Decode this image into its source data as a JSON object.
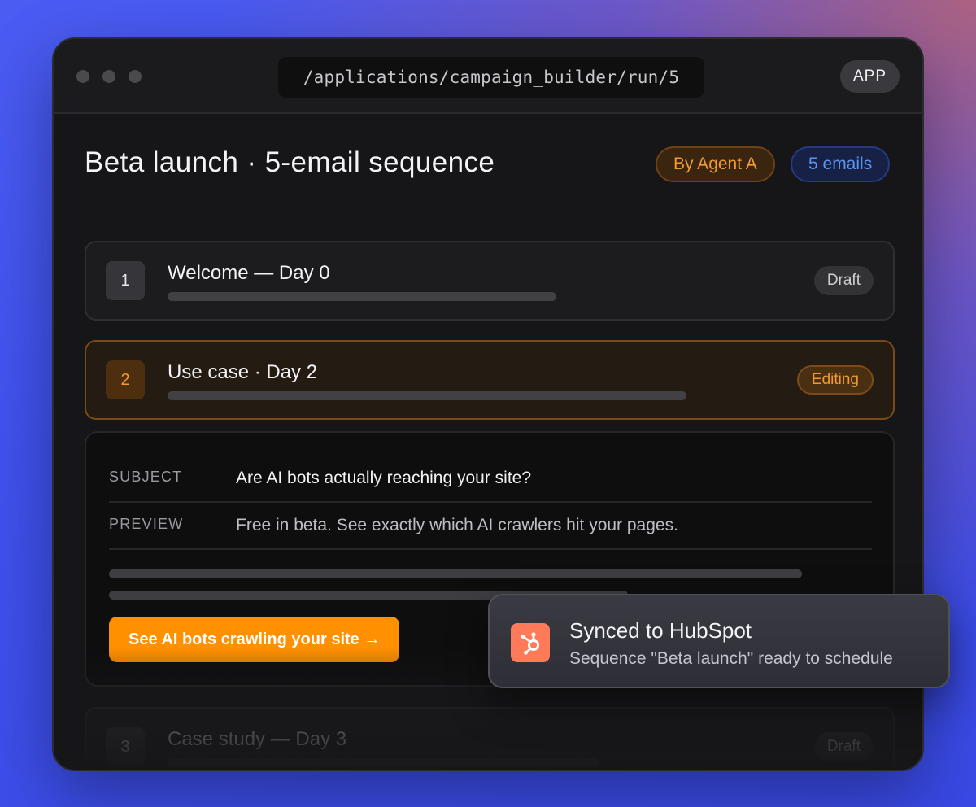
{
  "window": {
    "url": "/applications/campaign_builder/run/5",
    "badge": "APP"
  },
  "header": {
    "title": "Beta launch · 5-email sequence",
    "agent_pill": "By Agent A",
    "count_pill": "5 emails"
  },
  "emails": [
    {
      "number": "1",
      "title": "Welcome — Day 0",
      "status": "Draft"
    },
    {
      "number": "2",
      "title": "Use case · Day 2",
      "status": "Editing"
    },
    {
      "number": "3",
      "title": "Case study — Day 3",
      "status": "Draft"
    }
  ],
  "editor": {
    "subject_label": "SUBJECT",
    "subject_value": "Are AI bots actually reaching your site?",
    "preview_label": "PREVIEW",
    "preview_value": "Free in beta. See exactly which AI crawlers hit your pages.",
    "cta_label": "See AI bots crawling your site →"
  },
  "toast": {
    "icon": "hubspot-icon",
    "title": "Synced to HubSpot",
    "message": "Sequence \"Beta launch\" ready to schedule"
  },
  "colors": {
    "accent": "#ff9000",
    "agent": "#f29a2e",
    "count": "#5b95f4",
    "hubspot": "#ff7a59"
  }
}
